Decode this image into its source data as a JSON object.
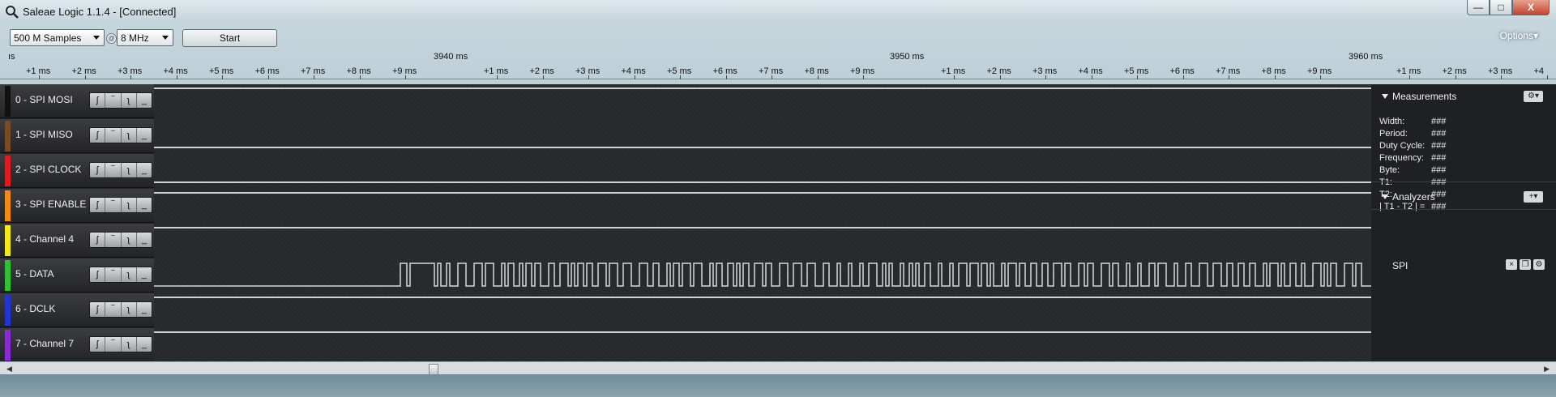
{
  "window": {
    "title": "Saleae Logic 1.1.4 - [Connected]",
    "buttons": {
      "minimize": "—",
      "maximize": "□",
      "close": "X"
    }
  },
  "toolbar": {
    "samples": "500 M Samples",
    "rate": "8 MHz",
    "start_label": "Start",
    "options_label": "Options▾"
  },
  "ruler": {
    "left_fragment": "ıs",
    "major": [
      "3940 ms",
      "3950 ms",
      "3960 ms"
    ],
    "minor_group": [
      "+1 ms",
      "+2 ms",
      "+3 ms",
      "+4 ms",
      "+5 ms",
      "+6 ms",
      "+7 ms",
      "+8 ms",
      "+9 ms"
    ],
    "tail": [
      "+1 ms",
      "+2 ms",
      "+3 ms",
      "+4"
    ]
  },
  "channels": [
    {
      "label": "0 - SPI MOSI",
      "color": "#111111"
    },
    {
      "label": "1 - SPI MISO",
      "color": "#7a4a22"
    },
    {
      "label": "2 - SPI CLOCK",
      "color": "#e01b1b"
    },
    {
      "label": "3 - SPI ENABLE",
      "color": "#f08a10"
    },
    {
      "label": "4 - Channel 4",
      "color": "#f2e81a"
    },
    {
      "label": "5 - DATA",
      "color": "#2fc12f"
    },
    {
      "label": "6 - DCLK",
      "color": "#2233d8"
    },
    {
      "label": "7 - Channel 7",
      "color": "#8a2bd6"
    }
  ],
  "trigger_glyphs": [
    "ʃ",
    "‾",
    "ʅ",
    "_"
  ],
  "measurements": {
    "title": "Measurements",
    "rows": [
      {
        "label": "Width:",
        "value": "###"
      },
      {
        "label": "Period:",
        "value": "###"
      },
      {
        "label": "Duty Cycle:",
        "value": "###"
      },
      {
        "label": "Frequency:",
        "value": "###"
      },
      {
        "label": "Byte:",
        "value": "###"
      },
      {
        "label": "T1:",
        "value": "###"
      },
      {
        "label": "T2:",
        "value": "###"
      },
      {
        "label": "| T1 - T2 | =",
        "value": "###"
      }
    ]
  },
  "analyzers": {
    "title": "Analyzers",
    "items": [
      "SPI"
    ]
  }
}
